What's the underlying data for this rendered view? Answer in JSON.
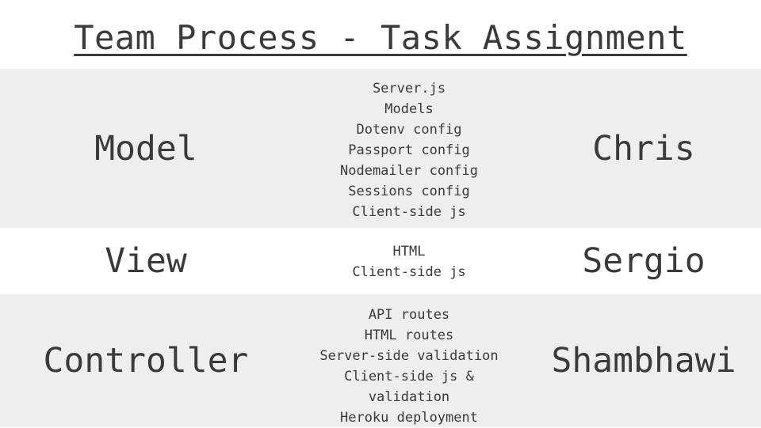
{
  "title": "Team Process - Task Assignment",
  "rows": [
    {
      "layer": "Model",
      "owner": "Chris",
      "tasks": [
        "Server.js",
        "Models",
        "Dotenv config",
        "Passport config",
        "Nodemailer config",
        "Sessions config",
        "Client-side js"
      ]
    },
    {
      "layer": "View",
      "owner": "Sergio",
      "tasks": [
        "HTML",
        "Client-side js"
      ]
    },
    {
      "layer": "Controller",
      "owner": "Shambhawi",
      "tasks": [
        "API routes",
        "HTML routes",
        "Server-side validation",
        "Client-side js &",
        "validation",
        "Heroku deployment"
      ]
    }
  ]
}
